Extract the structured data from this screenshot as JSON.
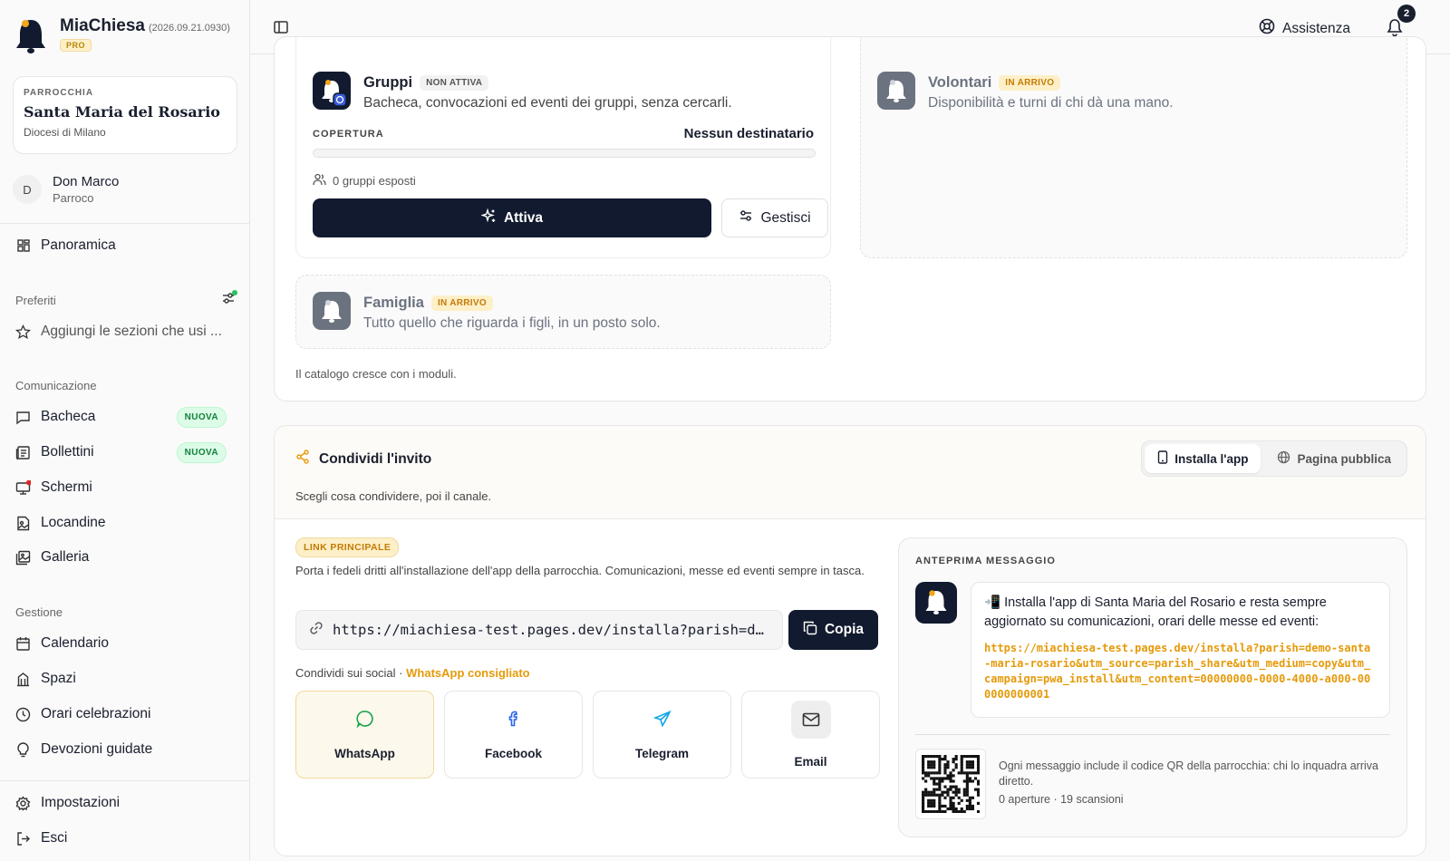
{
  "brand": {
    "name": "MiaChiesa",
    "version": "(2026.09.21.0930)",
    "plan": "PRO"
  },
  "parish": {
    "label": "PARROCCHIA",
    "name": "Santa Maria del Rosario",
    "diocese": "Diocesi di Milano"
  },
  "user": {
    "initial": "D",
    "name": "Don Marco",
    "role": "Parroco"
  },
  "sidebar": {
    "overview": "Panoramica",
    "favorites_label": "Preferiti",
    "favorites_empty": "Aggiungi le sezioni che usi ...",
    "communication_label": "Comunicazione",
    "communication": [
      {
        "label": "Bacheca",
        "badge": "NUOVA"
      },
      {
        "label": "Bollettini",
        "badge": "NUOVA"
      },
      {
        "label": "Schermi"
      },
      {
        "label": "Locandine"
      },
      {
        "label": "Galleria"
      }
    ],
    "management_label": "Gestione",
    "management": [
      {
        "label": "Calendario"
      },
      {
        "label": "Spazi"
      },
      {
        "label": "Orari celebrazioni"
      },
      {
        "label": "Devozioni guidate"
      }
    ],
    "settings": "Impostazioni",
    "logout": "Esci"
  },
  "topbar": {
    "help": "Assistenza",
    "notifications_count": "2"
  },
  "modules": {
    "gruppi": {
      "title": "Gruppi",
      "status": "NON ATTIVA",
      "desc": "Bacheca, convocazioni ed eventi dei gruppi, senza cercarli.",
      "coverage_label": "COPERTURA",
      "coverage_value": "Nessun destinatario",
      "coverage_fraction": 0,
      "groups_exposed": "0 gruppi esposti",
      "activate": "Attiva",
      "manage": "Gestisci"
    },
    "volontari": {
      "title": "Volontari",
      "status": "IN ARRIVO",
      "desc": "Disponibilità e turni di chi dà una mano."
    },
    "famiglia": {
      "title": "Famiglia",
      "status": "IN ARRIVO",
      "desc": "Tutto quello che riguarda i figli, in un posto solo."
    },
    "footer": "Il catalogo cresce con i moduli."
  },
  "share": {
    "title": "Condividi l'invito",
    "subtitle": "Scegli cosa condividere, poi il canale.",
    "tabs": [
      {
        "label": "Installa l'app",
        "active": true
      },
      {
        "label": "Pagina pubblica",
        "active": false
      }
    ],
    "link_tag": "LINK PRINCIPALE",
    "link_desc": "Porta i fedeli dritti all'installazione dell'app della parrocchia. Comunicazioni, messe ed eventi sempre in tasca.",
    "link_value": "https://miachiesa-test.pages.dev/installa?parish=demo-santa-maria-rosario",
    "copy": "Copia",
    "social_label": "Condividi sui social ·",
    "social_hint": "WhatsApp consigliato",
    "channels": [
      "WhatsApp",
      "Facebook",
      "Telegram",
      "Email"
    ],
    "preview_label": "ANTEPRIMA MESSAGGIO",
    "preview_text": "📲 Installa l'app di Santa Maria del Rosario e resta sempre aggiornato su comunicazioni, orari delle messe ed eventi:",
    "preview_link": "https://miachiesa-test.pages.dev/installa?parish=demo-santa-maria-rosario&utm_source=parish_share&utm_medium=copy&utm_campaign=pwa_install&utm_content=00000000-0000-4000-a000-000000000001",
    "qr_note": "Ogni messaggio include il codice QR della parrocchia: chi lo inquadra arriva diretto.",
    "qr_stats": "0 aperture · 19 scansioni"
  },
  "colors": {
    "accent": "#e59a0a",
    "dark": "#111a2e",
    "green": "#15803d",
    "notif_dot": "#dc2626"
  }
}
